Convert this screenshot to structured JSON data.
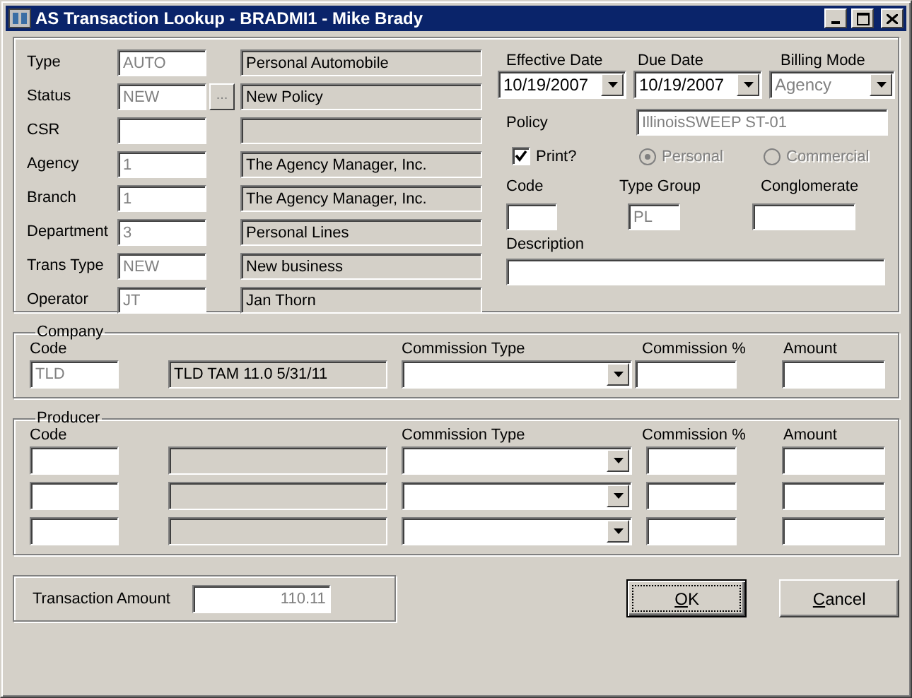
{
  "window": {
    "title": "AS Transaction Lookup - BRADMI1 - Mike Brady"
  },
  "header_fields": [
    {
      "label": "Type",
      "code": "AUTO",
      "code_disabled": true,
      "description": "Personal Automobile"
    },
    {
      "label": "Status",
      "code": "NEW",
      "code_disabled": true,
      "description": "New Policy",
      "lookup": "..."
    },
    {
      "label": "CSR"
    },
    {
      "label": "Agency",
      "code": "1",
      "code_disabled": true,
      "description": "The Agency Manager, Inc."
    },
    {
      "label": "Branch",
      "code": "1",
      "code_disabled": true,
      "description": "The Agency Manager, Inc."
    },
    {
      "label": "Department",
      "code": "3",
      "code_disabled": true,
      "description": "Personal Lines"
    },
    {
      "label": "Trans Type",
      "code": "NEW",
      "code_disabled": true,
      "description": "New business"
    },
    {
      "label": "Operator",
      "code": "JT",
      "code_disabled": true,
      "description": "Jan Thorn"
    }
  ],
  "dates": [
    {
      "label": "Effective Date",
      "value": "10/19/2007",
      "disabled": false
    },
    {
      "label": "Due Date",
      "value": "10/19/2007",
      "disabled": false
    },
    {
      "label": "Billing Mode",
      "value": "Agency",
      "disabled": true
    }
  ],
  "policy": {
    "label": "Policy",
    "value": "IllinoisSWEEP ST-01",
    "disabled": true
  },
  "print": {
    "label": "Print?",
    "checked": true
  },
  "policy_types": [
    {
      "label": "Personal",
      "selected": true,
      "disabled": true
    },
    {
      "label": "Commercial",
      "selected": false,
      "disabled": true
    }
  ],
  "codes": [
    {
      "label": "Code"
    },
    {
      "label": "Type Group",
      "value": "PL",
      "disabled": true
    },
    {
      "label": "Conglomerate"
    }
  ],
  "description": {
    "label": "Description"
  },
  "company": {
    "title": "Company",
    "columns": [
      "Code",
      "Commission Type",
      "Commission %",
      "Amount"
    ],
    "rows": [
      {
        "code": "TLD",
        "code_disabled": true,
        "name": "TLD TAM 11.0 5/31/11"
      }
    ]
  },
  "producer": {
    "title": "Producer",
    "columns": [
      "Code",
      "Commission Type",
      "Commission %",
      "Amount"
    ],
    "rows": [
      {},
      {},
      {}
    ]
  },
  "transaction_amount": {
    "label": "Transaction Amount",
    "value": "110.11"
  },
  "buttons": [
    {
      "label": "OK",
      "default": true
    },
    {
      "label": "Cancel",
      "default": false
    }
  ]
}
